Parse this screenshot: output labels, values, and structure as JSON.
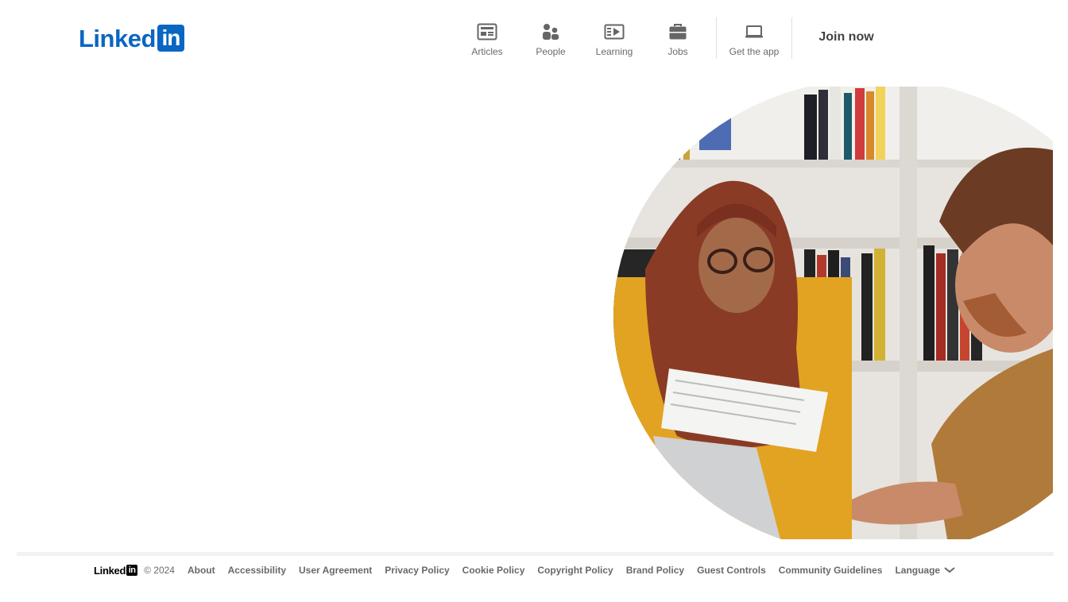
{
  "brand": {
    "word": "Linked",
    "box": "in",
    "color": "#0a66c2"
  },
  "nav": [
    {
      "label": "Articles",
      "icon": "articles-icon"
    },
    {
      "label": "People",
      "icon": "people-icon"
    },
    {
      "label": "Learning",
      "icon": "learning-icon"
    },
    {
      "label": "Jobs",
      "icon": "jobs-icon"
    },
    {
      "label": "Get the app",
      "icon": "laptop-icon"
    }
  ],
  "join_label": "Join now",
  "footer": {
    "logo_word": "Linked",
    "logo_box": "in",
    "copyright": "© 2024",
    "links": [
      "About",
      "Accessibility",
      "User Agreement",
      "Privacy Policy",
      "Cookie Policy",
      "Copyright Policy",
      "Brand Policy",
      "Guest Controls",
      "Community Guidelines"
    ],
    "language": "Language"
  }
}
